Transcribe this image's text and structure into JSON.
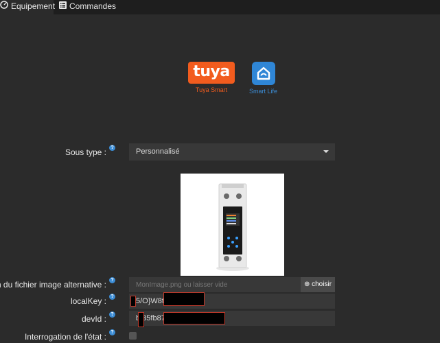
{
  "tabs": [
    {
      "label": "Equipement",
      "icon": "tachometer-icon",
      "active": true
    },
    {
      "label": "Commandes",
      "icon": "list-icon",
      "active": false
    }
  ],
  "logos": {
    "tuya": {
      "text": "tuya",
      "label": "Tuya Smart",
      "color": "#f25c1e"
    },
    "smartlife": {
      "label": "Smart Life",
      "color": "#2f86d6"
    }
  },
  "form": {
    "sous_type": {
      "label": "Sous type :",
      "value": "Personnalisé"
    },
    "image_alt": {
      "label": "Nom du fichier image alternative :",
      "placeholder": "MonImage.png ou laisser vide",
      "button": "choisir"
    },
    "local_key": {
      "label": "localKey :",
      "value": "5/O}W8t("
    },
    "dev_id": {
      "label": "devId :",
      "value": "b   35fb87"
    },
    "interrogation": {
      "label": "Interrogation de l'état :",
      "checked": false
    }
  },
  "colors": {
    "accent_blue": "#3c8dd6",
    "redaction_border": "#c0392b"
  }
}
